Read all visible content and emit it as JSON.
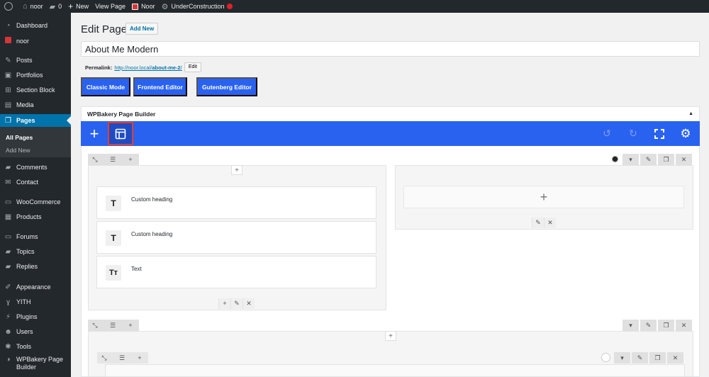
{
  "adminbar": {
    "site_name": "noor",
    "comments_count": "0",
    "new_label": "New",
    "view_page_label": "View Page",
    "plugin_label": "Noor",
    "under_construction_label": "UnderConstruction"
  },
  "sidebar": {
    "items": [
      {
        "label": "Dashboard",
        "icon": "dashboard-icon"
      },
      {
        "label": "noor",
        "icon": "noor-icon"
      },
      {
        "label": "Posts",
        "icon": "pin-icon"
      },
      {
        "label": "Portfolios",
        "icon": "portfolio-icon"
      },
      {
        "label": "Section Block",
        "icon": "grid-icon"
      },
      {
        "label": "Media",
        "icon": "media-icon"
      },
      {
        "label": "Pages",
        "icon": "pages-icon"
      },
      {
        "label": "Comments",
        "icon": "comment-icon"
      },
      {
        "label": "Contact",
        "icon": "mail-icon"
      },
      {
        "label": "WooCommerce",
        "icon": "woocommerce-icon"
      },
      {
        "label": "Products",
        "icon": "products-icon"
      },
      {
        "label": "Forums",
        "icon": "forums-icon"
      },
      {
        "label": "Topics",
        "icon": "topics-icon"
      },
      {
        "label": "Replies",
        "icon": "replies-icon"
      },
      {
        "label": "Appearance",
        "icon": "brush-icon"
      },
      {
        "label": "YITH",
        "icon": "yith-icon"
      },
      {
        "label": "Plugins",
        "icon": "plugin-icon"
      },
      {
        "label": "Users",
        "icon": "user-icon"
      },
      {
        "label": "Tools",
        "icon": "wrench-icon"
      },
      {
        "label": "WPBakery Page",
        "icon": "wpbakery-icon"
      }
    ],
    "wpbakery_line2": "Builder",
    "submenu": [
      "All Pages",
      "Add New"
    ]
  },
  "header": {
    "title": "Edit Page",
    "add_new": "Add New"
  },
  "editor": {
    "post_title": "About Me Modern",
    "permalink_label": "Permalink:",
    "permalink_base": "http://noor.local/",
    "permalink_slug": "about-me-2",
    "permalink_end": "/",
    "edit_label": "Edit"
  },
  "modes": {
    "classic": "Classic Mode",
    "frontend": "Frontend Editor",
    "gutenberg": "Gutenberg Editor"
  },
  "wpbakery": {
    "title": "WPBakery Page Builder",
    "elements": [
      {
        "label": "Custom heading",
        "icon_text": "T"
      },
      {
        "label": "Custom heading",
        "icon_text": "T"
      },
      {
        "label": "Text",
        "icon_text": "Tт"
      }
    ]
  },
  "colors": {
    "accent": "#2a62f0",
    "highlight": "#e2402b",
    "sidebar_bg": "#23282d",
    "active_menu": "#0073aa"
  }
}
